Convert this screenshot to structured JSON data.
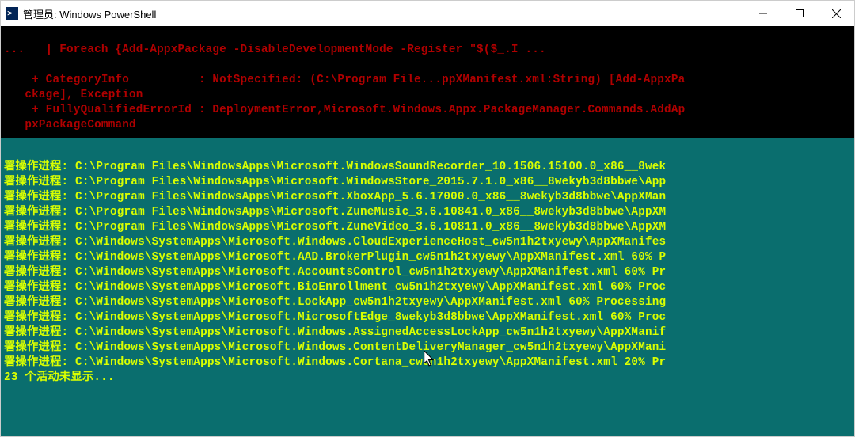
{
  "window": {
    "title": "管理员: Windows PowerShell"
  },
  "error": {
    "line1": "...   | Foreach {Add-AppxPackage -DisableDevelopmentMode -Register \"$($_.I ...",
    "line2": "",
    "line3": "    + CategoryInfo          : NotSpecified: (C:\\Program File...ppXManifest.xml:String) [Add-AppxPa",
    "line4": "   ckage], Exception",
    "line5": "    + FullyQualifiedErrorId : DeploymentError,Microsoft.Windows.Appx.PackageManager.Commands.AddAp",
    "line6": "   pxPackageCommand"
  },
  "prefix": "署操作进程:",
  "progress": [
    "C:\\Program Files\\WindowsApps\\Microsoft.WindowsSoundRecorder_10.1506.15100.0_x86__8wek",
    "C:\\Program Files\\WindowsApps\\Microsoft.WindowsStore_2015.7.1.0_x86__8wekyb3d8bbwe\\App",
    "C:\\Program Files\\WindowsApps\\Microsoft.XboxApp_5.6.17000.0_x86__8wekyb3d8bbwe\\AppXMan",
    "C:\\Program Files\\WindowsApps\\Microsoft.ZuneMusic_3.6.10841.0_x86__8wekyb3d8bbwe\\AppXM",
    "C:\\Program Files\\WindowsApps\\Microsoft.ZuneVideo_3.6.10811.0_x86__8wekyb3d8bbwe\\AppXM",
    "C:\\Windows\\SystemApps\\Microsoft.Windows.CloudExperienceHost_cw5n1h2txyewy\\AppXManifes",
    "C:\\Windows\\SystemApps\\Microsoft.AAD.BrokerPlugin_cw5n1h2txyewy\\AppXManifest.xml 60% P",
    "C:\\Windows\\SystemApps\\Microsoft.AccountsControl_cw5n1h2txyewy\\AppXManifest.xml 60% Pr",
    "C:\\Windows\\SystemApps\\Microsoft.BioEnrollment_cw5n1h2txyewy\\AppXManifest.xml 60% Proc",
    "C:\\Windows\\SystemApps\\Microsoft.LockApp_cw5n1h2txyewy\\AppXManifest.xml 60% Processing",
    "C:\\Windows\\SystemApps\\Microsoft.MicrosoftEdge_8wekyb3d8bbwe\\AppXManifest.xml 60% Proc",
    "C:\\Windows\\SystemApps\\Microsoft.Windows.AssignedAccessLockApp_cw5n1h2txyewy\\AppXManif",
    "C:\\Windows\\SystemApps\\Microsoft.Windows.ContentDeliveryManager_cw5n1h2txyewy\\AppXMani",
    "C:\\Windows\\SystemApps\\Microsoft.Windows.Cortana_cw5n1h2txyewy\\AppXManifest.xml 20% Pr"
  ],
  "footer": "23 个活动未显示..."
}
